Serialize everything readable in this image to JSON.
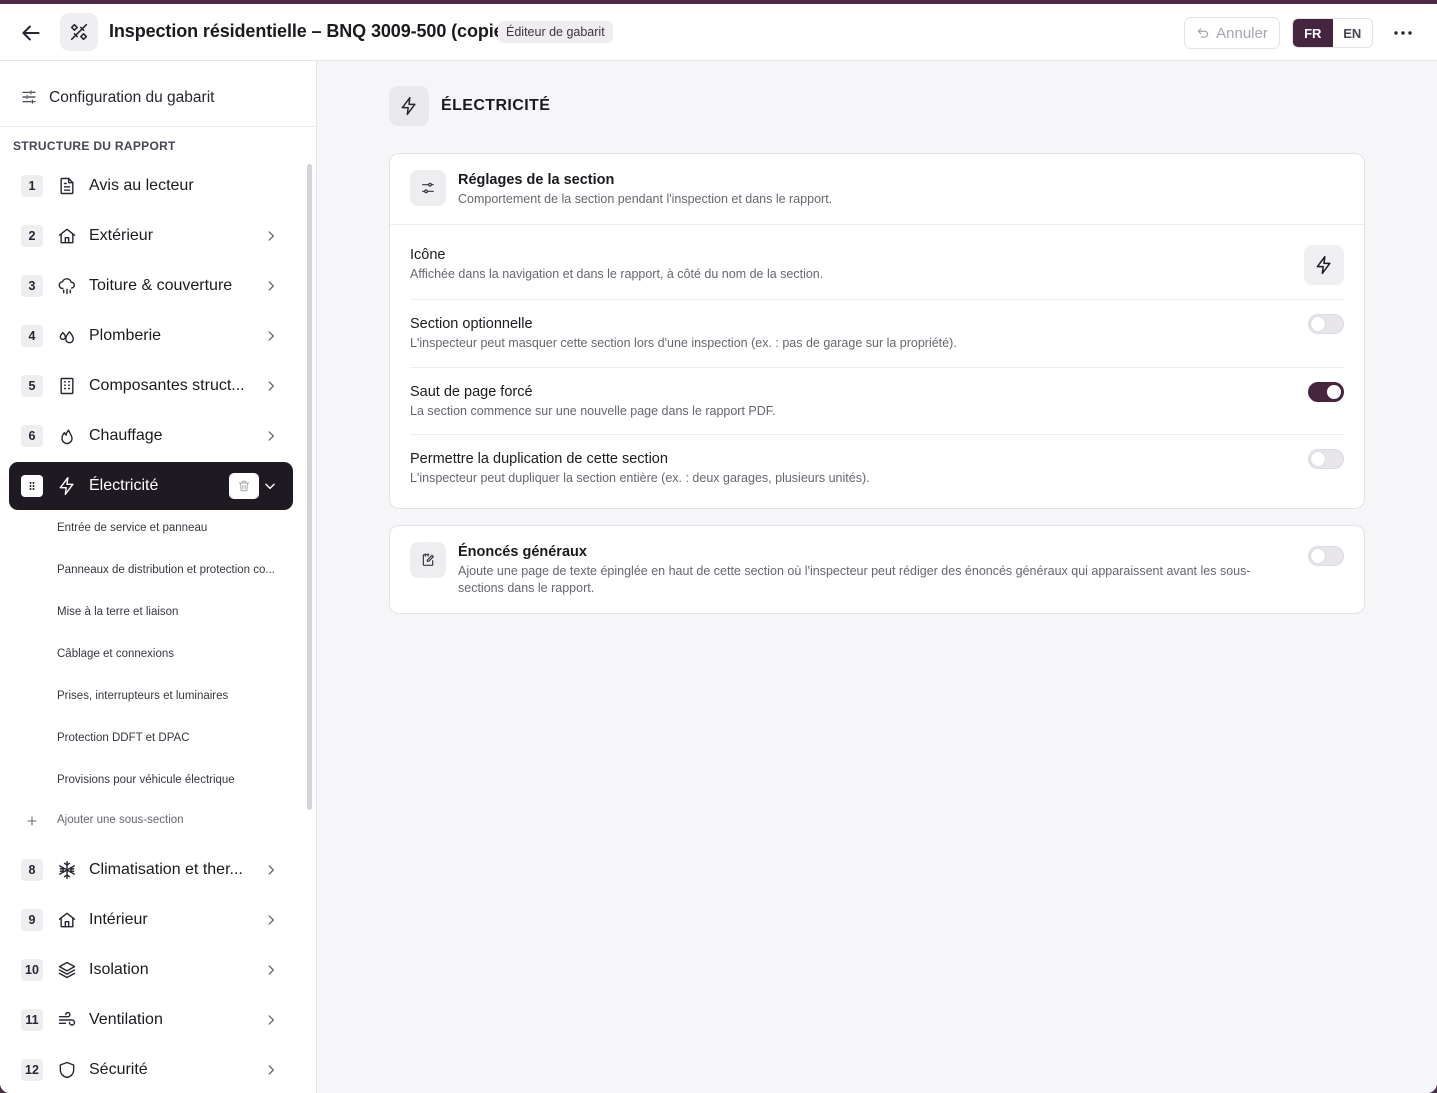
{
  "header": {
    "title": "Inspection résidentielle – BNQ 3009-500 (copie)",
    "badge": "Éditeur de gabarit",
    "undo_label": "Annuler",
    "lang_fr": "FR",
    "lang_en": "EN"
  },
  "sidebar": {
    "config_label": "Configuration du gabarit",
    "structure_label": "STRUCTURE DU RAPPORT",
    "items": [
      {
        "num": "1",
        "label": "Avis au lecteur",
        "icon": "document-icon"
      },
      {
        "num": "2",
        "label": "Extérieur",
        "icon": "house-icon"
      },
      {
        "num": "3",
        "label": "Toiture & couverture",
        "icon": "cloud-rain-icon"
      },
      {
        "num": "4",
        "label": "Plomberie",
        "icon": "droplets-icon"
      },
      {
        "num": "5",
        "label": "Composantes struct...",
        "icon": "building-icon"
      },
      {
        "num": "6",
        "label": "Chauffage",
        "icon": "flame-icon"
      },
      {
        "num": "",
        "label": "Électricité",
        "icon": "zap-icon"
      },
      {
        "num": "8",
        "label": "Climatisation et ther...",
        "icon": "snowflake-icon"
      },
      {
        "num": "9",
        "label": "Intérieur",
        "icon": "house-icon"
      },
      {
        "num": "10",
        "label": "Isolation",
        "icon": "layers-icon"
      },
      {
        "num": "11",
        "label": "Ventilation",
        "icon": "wind-icon"
      },
      {
        "num": "12",
        "label": "Sécurité",
        "icon": "shield-icon"
      }
    ],
    "subitems": [
      "Entrée de service et panneau",
      "Panneaux de distribution et protection co...",
      "Mise à la terre et liaison",
      "Câblage et connexions",
      "Prises, interrupteurs et luminaires",
      "Protection DDFT et DPAC",
      "Provisions pour véhicule électrique"
    ],
    "add_sub_label": "Ajouter une sous-section"
  },
  "main": {
    "section_title": "ÉLECTRICITÉ",
    "settings": {
      "title": "Réglages de la section",
      "desc": "Comportement de la section pendant l'inspection et dans le rapport.",
      "rows": [
        {
          "title": "Icône",
          "desc": "Affichée dans la navigation et dans le rapport, à côté du nom de la section."
        },
        {
          "title": "Section optionnelle",
          "desc": "L'inspecteur peut masquer cette section lors d'une inspection (ex. : pas de garage sur la propriété).",
          "on": false
        },
        {
          "title": "Saut de page forcé",
          "desc": "La section commence sur une nouvelle page dans le rapport PDF.",
          "on": true
        },
        {
          "title": "Permettre la duplication de cette section",
          "desc": "L'inspecteur peut dupliquer la section entière (ex. : deux garages, plusieurs unités).",
          "on": false
        }
      ]
    },
    "general": {
      "title": "Énoncés généraux",
      "desc": "Ajoute une page de texte épinglée en haut de cette section où l'inspecteur peut rédiger des énoncés généraux qui apparaissent avant les sous-sections dans le rapport.",
      "on": false
    }
  },
  "colors": {
    "accent": "#45253f",
    "active_nav": "#1f1a22",
    "top_bar": "#4a2c47"
  }
}
